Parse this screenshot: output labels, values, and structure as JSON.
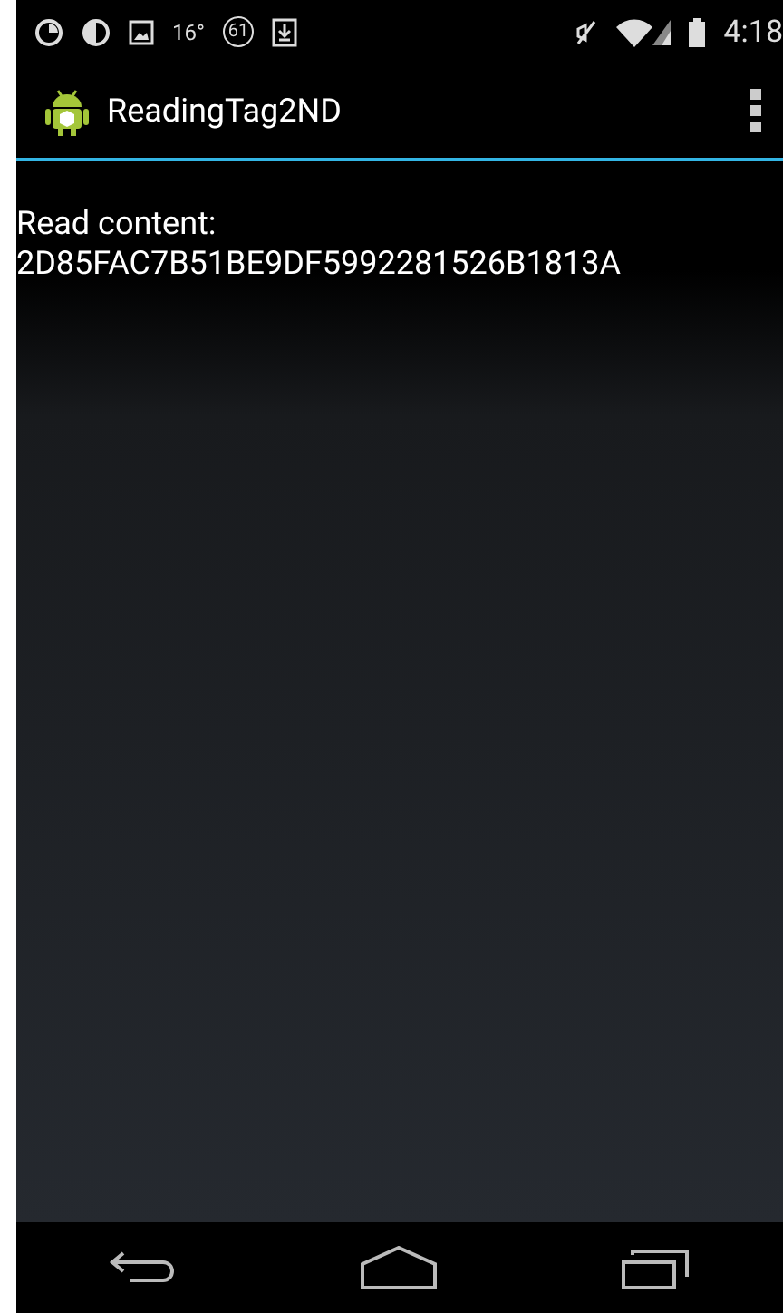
{
  "status_bar": {
    "temperature": "16°",
    "badge": "61",
    "time": "4:18"
  },
  "action_bar": {
    "title": "ReadingTag2ND"
  },
  "content": {
    "label": "Read content:",
    "value": "2D85FAC7B51BE9DF5992281526B1813A"
  }
}
